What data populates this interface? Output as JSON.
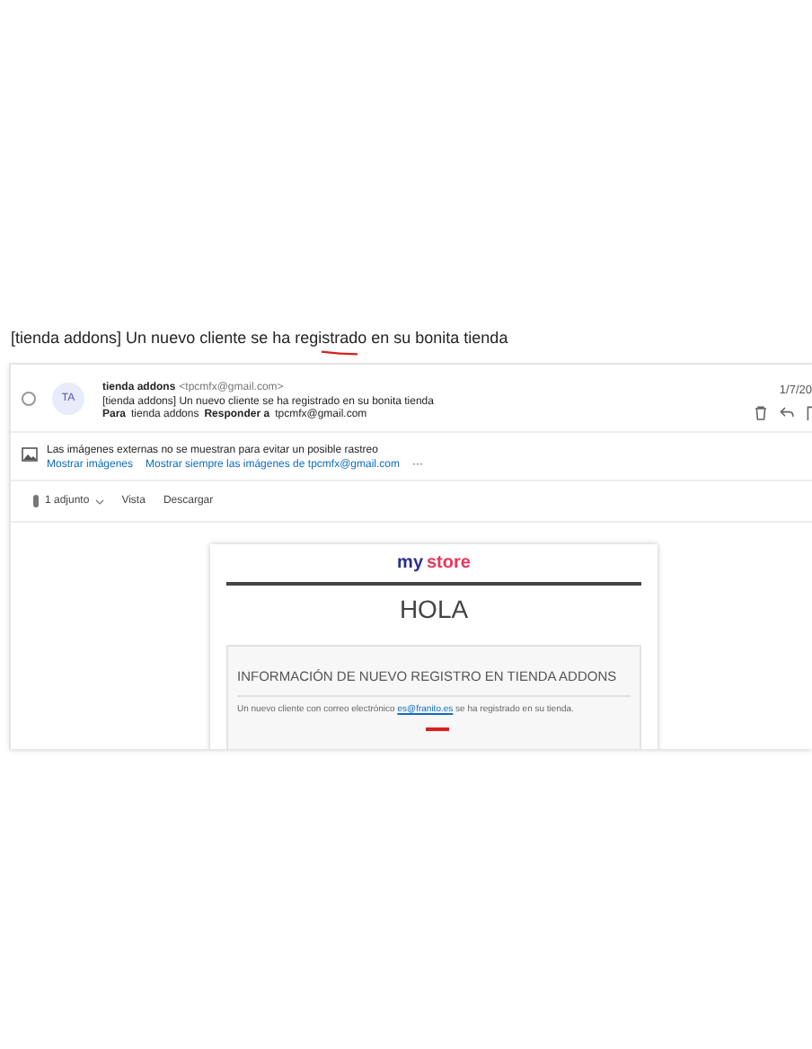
{
  "subject": "[tienda addons] Un nuevo cliente se ha registrado en su bonita tienda",
  "message": {
    "selected": false,
    "avatar": "TA",
    "sender_name": "tienda addons",
    "sender_email": "<tpcmfx@gmail.com>",
    "subject_line": "[tienda addons] Un nuevo cliente se ha registrado en su bonita tienda",
    "to_label": "Para",
    "to": "tienda addons",
    "reply_to_label": "Responder a",
    "reply_to": "tpcmfx@gmail.com",
    "date": "1/7/20"
  },
  "images_notice": {
    "text": "Las imágenes externas no se muestran para evitar un posible rastreo",
    "links": [
      "Mostrar imágenes",
      "Mostrar siempre las imágenes de tpcmfx@gmail.com"
    ],
    "more": "···"
  },
  "attachments": {
    "count": "1 adjunto",
    "actions": [
      "Vista",
      "Descargar"
    ]
  },
  "email_body": {
    "logo": [
      "my",
      "store"
    ],
    "greeting": "HOLA",
    "section_title": "INFORMACIÓN DE NUEVO REGISTRO EN TIENDA ADDONS",
    "text_before": "Un nuevo cliente con correo electrónico ",
    "email_link": "es@franito.es",
    "text_after": " se ha registrado en su tienda."
  }
}
